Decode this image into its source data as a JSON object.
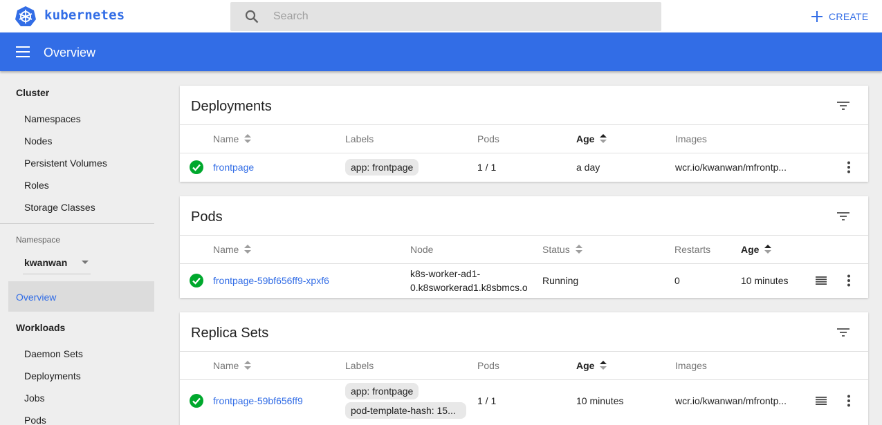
{
  "header": {
    "brand": "kubernetes",
    "search_placeholder": "Search",
    "create_label": "CREATE"
  },
  "toolbar": {
    "title": "Overview"
  },
  "sidebar": {
    "cluster_heading": "Cluster",
    "cluster_items": [
      "Namespaces",
      "Nodes",
      "Persistent Volumes",
      "Roles",
      "Storage Classes"
    ],
    "namespace_label": "Namespace",
    "namespace_value": "kwanwan",
    "active_item": "Overview",
    "workloads_heading": "Workloads",
    "workload_items": [
      "Daemon Sets",
      "Deployments",
      "Jobs",
      "Pods"
    ]
  },
  "deployments": {
    "title": "Deployments",
    "columns": [
      "Name",
      "Labels",
      "Pods",
      "Age",
      "Images"
    ],
    "rows": [
      {
        "name": "frontpage",
        "labels": [
          "app: frontpage"
        ],
        "pods": "1 / 1",
        "age": "a day",
        "images": "wcr.io/kwanwan/mfrontp..."
      }
    ]
  },
  "pods": {
    "title": "Pods",
    "columns": [
      "Name",
      "Node",
      "Status",
      "Restarts",
      "Age"
    ],
    "rows": [
      {
        "name": "frontpage-59bf656ff9-xpxf6",
        "node_line1": "k8s-worker-ad1-",
        "node_line2": "0.k8sworkerad1.k8sbmcs.o",
        "status": "Running",
        "restarts": "0",
        "age": "10 minutes"
      }
    ]
  },
  "replica_sets": {
    "title": "Replica Sets",
    "columns": [
      "Name",
      "Labels",
      "Pods",
      "Age",
      "Images"
    ],
    "rows": [
      {
        "name": "frontpage-59bf656ff9",
        "labels": [
          "app: frontpage",
          "pod-template-hash: 15..."
        ],
        "pods": "1 / 1",
        "age": "10 minutes",
        "images": "wcr.io/kwanwan/mfrontp..."
      }
    ]
  },
  "colors": {
    "accent": "#326de6",
    "success": "#00a82d",
    "page_bg": "#eeeeee"
  },
  "icons": [
    "kubernetes-logo",
    "search-icon",
    "plus-icon",
    "menu-icon",
    "filter-icon",
    "check-circle-icon",
    "more-vert-icon",
    "logs-icon"
  ]
}
